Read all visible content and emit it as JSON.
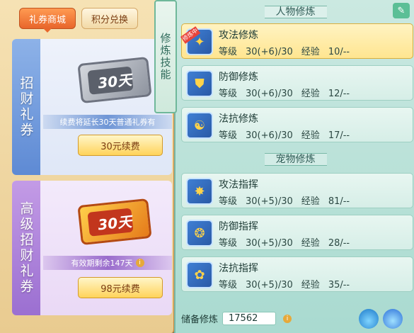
{
  "shop": {
    "tabs": [
      {
        "label": "礼券商城",
        "active": true
      },
      {
        "label": "积分兑换",
        "active": false
      }
    ],
    "cards": [
      {
        "title": "招财礼券",
        "ticket": "30天",
        "info": "续费将延长30天普通礼券有",
        "button": "30元续费"
      },
      {
        "title": "高级招财礼券",
        "ticket": "30天",
        "info": "有效期剩余147天",
        "button": "98元续费"
      }
    ]
  },
  "side_tab": "修炼技能",
  "cultivation": {
    "person_title": "人物修炼",
    "pet_title": "宠物修炼",
    "level_label": "等级",
    "exp_label": "经验",
    "person": [
      {
        "name": "攻法修炼",
        "level": "30(+6)/30",
        "exp": "10/--",
        "tag": "修炼中",
        "selected": true,
        "icon": "attack-spell-icon"
      },
      {
        "name": "防御修炼",
        "level": "30(+6)/30",
        "exp": "12/--",
        "icon": "defense-icon"
      },
      {
        "name": "法抗修炼",
        "level": "30(+6)/30",
        "exp": "17/--",
        "icon": "resistance-icon"
      }
    ],
    "pet": [
      {
        "name": "攻法指挥",
        "level": "30(+5)/30",
        "exp": "81/--",
        "icon": "paw-attack-icon"
      },
      {
        "name": "防御指挥",
        "level": "30(+5)/30",
        "exp": "28/--",
        "icon": "paw-defense-icon"
      },
      {
        "name": "法抗指挥",
        "level": "30(+5)/30",
        "exp": "35/--",
        "icon": "paw-resist-icon"
      }
    ],
    "reserve_label": "储备修炼",
    "reserve_value": "17562"
  }
}
